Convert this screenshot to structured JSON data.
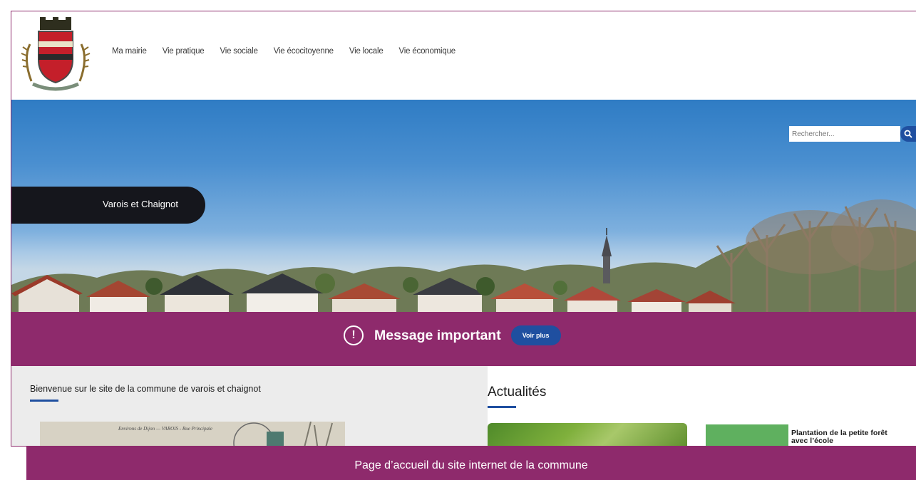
{
  "nav": {
    "items": [
      "Ma mairie",
      "Vie pratique",
      "Vie sociale",
      "Vie écocitoyenne",
      "Vie locale",
      "Vie économique"
    ]
  },
  "search": {
    "placeholder": "Rechercher..."
  },
  "hero": {
    "town_name": "Varois et Chaignot"
  },
  "banner": {
    "message": "Message important",
    "button_label": "Voir plus"
  },
  "welcome": {
    "text": "Bienvenue sur le site de la commune de varois et chaignot",
    "postcard_caption": "Environs de Dijon — VAROIS - Rue Principale"
  },
  "news": {
    "title": "Actualités",
    "card2_title": "Plantation de la petite forêt avec l’école"
  },
  "caption": {
    "text": "Page d’accueil du site internet de la commune"
  },
  "colors": {
    "brand": "#8e2a6c",
    "accent": "#1f4fa0",
    "dark": "#15161c"
  },
  "icons": {
    "search": "search-icon",
    "warning": "exclamation-circle-icon",
    "logo": "coat-of-arms-icon"
  }
}
